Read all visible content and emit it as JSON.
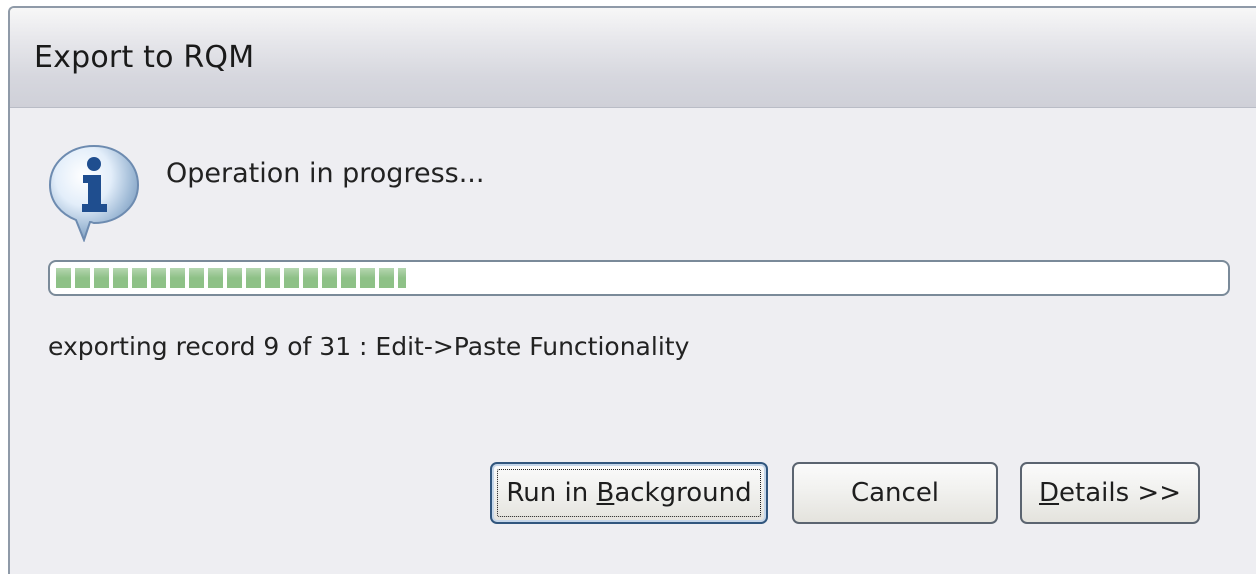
{
  "window": {
    "title": "Export to RQM"
  },
  "status": {
    "icon": "info-icon",
    "message": "Operation in progress..."
  },
  "progress": {
    "fraction": 0.3,
    "accent_color": "#8ec187",
    "detail": "exporting record 9 of 31 : Edit->Paste Functionality"
  },
  "buttons": {
    "run_background": {
      "prefix": "Run in ",
      "mnemonic": "B",
      "suffix": "ackground"
    },
    "cancel": {
      "label": "Cancel"
    },
    "details": {
      "mnemonic": "D",
      "suffix": "etails >>"
    }
  }
}
